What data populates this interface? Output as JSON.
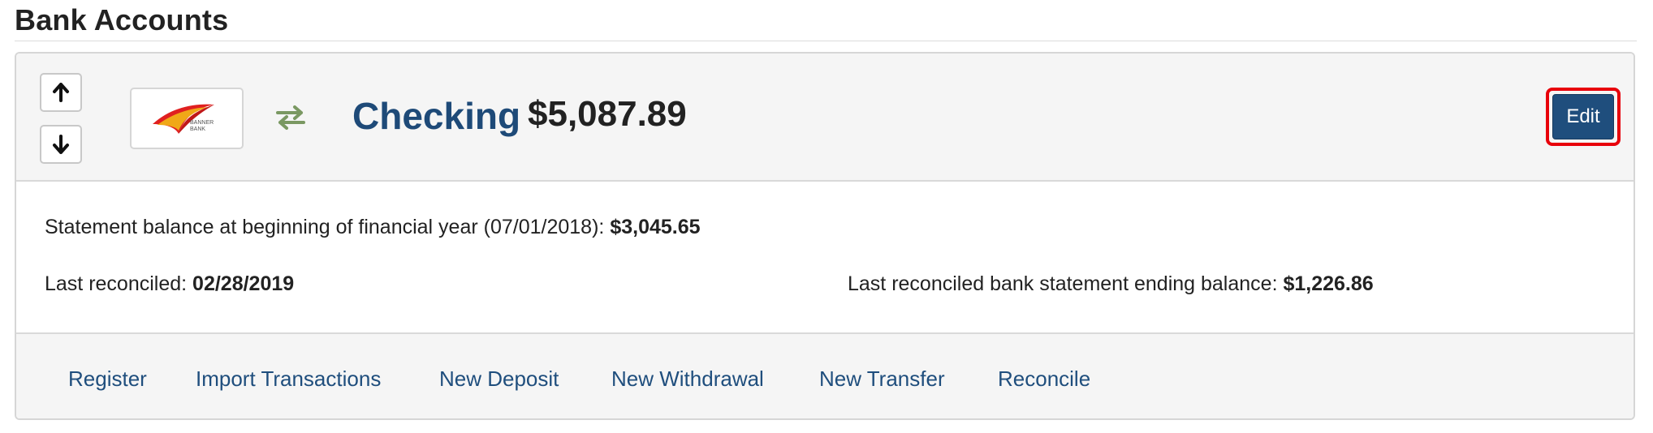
{
  "page": {
    "title": "Bank Accounts"
  },
  "account": {
    "bank_logo_text": "BANNER BANK",
    "name": "Checking",
    "balance": "$5,087.89",
    "edit_label": "Edit"
  },
  "details": {
    "fy_label": "Statement balance at beginning of financial year (07/01/2018): ",
    "fy_value": "$3,045.65",
    "last_reconciled_label": "Last reconciled: ",
    "last_reconciled_value": "02/28/2019",
    "ending_balance_label": "Last reconciled bank statement ending balance: ",
    "ending_balance_value": "$1,226.86"
  },
  "actions": {
    "register": "Register",
    "import": "Import Transactions",
    "deposit": "New Deposit",
    "withdrawal": "New Withdrawal",
    "transfer": "New Transfer",
    "reconcile": "Reconcile"
  },
  "colors": {
    "link": "#1f4e7d",
    "edit_button": "#1f4e7d",
    "highlight": "#e8000b",
    "transfer_icon": "#7a9862"
  },
  "icons": {
    "move_up": "arrow-up-icon",
    "move_down": "arrow-down-icon",
    "transfer": "transfer-arrows-icon"
  }
}
